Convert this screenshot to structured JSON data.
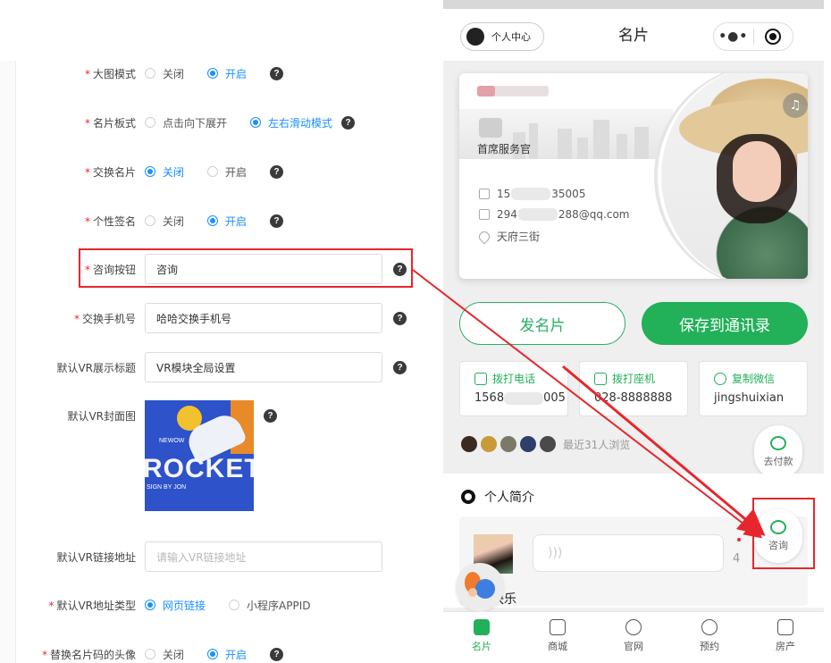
{
  "form": {
    "rows": [
      {
        "label": "大图模式",
        "required": true,
        "type": "radio",
        "options": [
          "关闭",
          "开启"
        ],
        "selected": 1,
        "help": "?"
      },
      {
        "label": "名片板式",
        "required": true,
        "type": "radio",
        "options": [
          "点击向下展开",
          "左右滑动模式"
        ],
        "selected": 1,
        "help": "?"
      },
      {
        "label": "交换名片",
        "required": true,
        "type": "radio",
        "options": [
          "关闭",
          "开启"
        ],
        "selected": 0,
        "help": "?"
      },
      {
        "label": "个性签名",
        "required": true,
        "type": "radio",
        "options": [
          "关闭",
          "开启"
        ],
        "selected": 1,
        "help": "?"
      },
      {
        "label": "咨询按钮",
        "required": true,
        "type": "input",
        "value": "咨询",
        "help": "?"
      },
      {
        "label": "交换手机号",
        "required": true,
        "type": "input",
        "value": "哈哈交换手机号",
        "help": "?"
      },
      {
        "label": "默认VR展示标题",
        "required": false,
        "type": "input",
        "value": "VR模块全局设置",
        "help": "?"
      },
      {
        "label": "默认VR封面图",
        "required": false,
        "type": "image",
        "help": "?"
      },
      {
        "label": "默认VR链接地址",
        "required": false,
        "type": "input",
        "placeholder": "请输入VR链接地址"
      },
      {
        "label": "默认VR地址类型",
        "required": true,
        "type": "radio",
        "options": [
          "网页链接",
          "小程序APPID"
        ],
        "selected": 0
      },
      {
        "label": "替换名片码的头像",
        "required": true,
        "type": "radio",
        "options": [
          "关闭",
          "开启"
        ],
        "selected": 1,
        "help": "?"
      }
    ],
    "cover_image": {
      "big_text": "ROCKET",
      "top_text": "NEWOW",
      "bottom_text": "SIGN BY JON"
    }
  },
  "phone": {
    "nav": {
      "center_pill": "个人中心",
      "title": "名片",
      "more": "•●•"
    },
    "card": {
      "position": "首席服务官",
      "phone_prefix": "15",
      "phone_suffix": "35005",
      "email_prefix": "294",
      "email_suffix": "288@qq.com",
      "address": "天府三街",
      "music": "♫"
    },
    "buttons": {
      "send": "发名片",
      "save": "保存到通讯录"
    },
    "quick": [
      {
        "title": "拨打电话",
        "value_prefix": "1568",
        "value_suffix": "005"
      },
      {
        "title": "拨打座机",
        "value": "028-8888888"
      },
      {
        "title": "复制微信",
        "value": "jingshuixian"
      }
    ],
    "visitors_text": "最近31人浏览",
    "pay_fab": "去付款",
    "consult_fab": "咨询",
    "intro": {
      "title": "个人简介",
      "voice_glyph": "))) ",
      "duration": "4",
      "festival": "节快乐"
    },
    "tabs": [
      {
        "label": "名片",
        "active": true
      },
      {
        "label": "商城",
        "active": false
      },
      {
        "label": "官网",
        "active": false
      },
      {
        "label": "预约",
        "active": false
      },
      {
        "label": "房产",
        "active": false
      }
    ]
  },
  "colors": {
    "accent_green": "#22b059",
    "radio_blue": "#1890ff",
    "highlight_red": "#e6262c"
  }
}
